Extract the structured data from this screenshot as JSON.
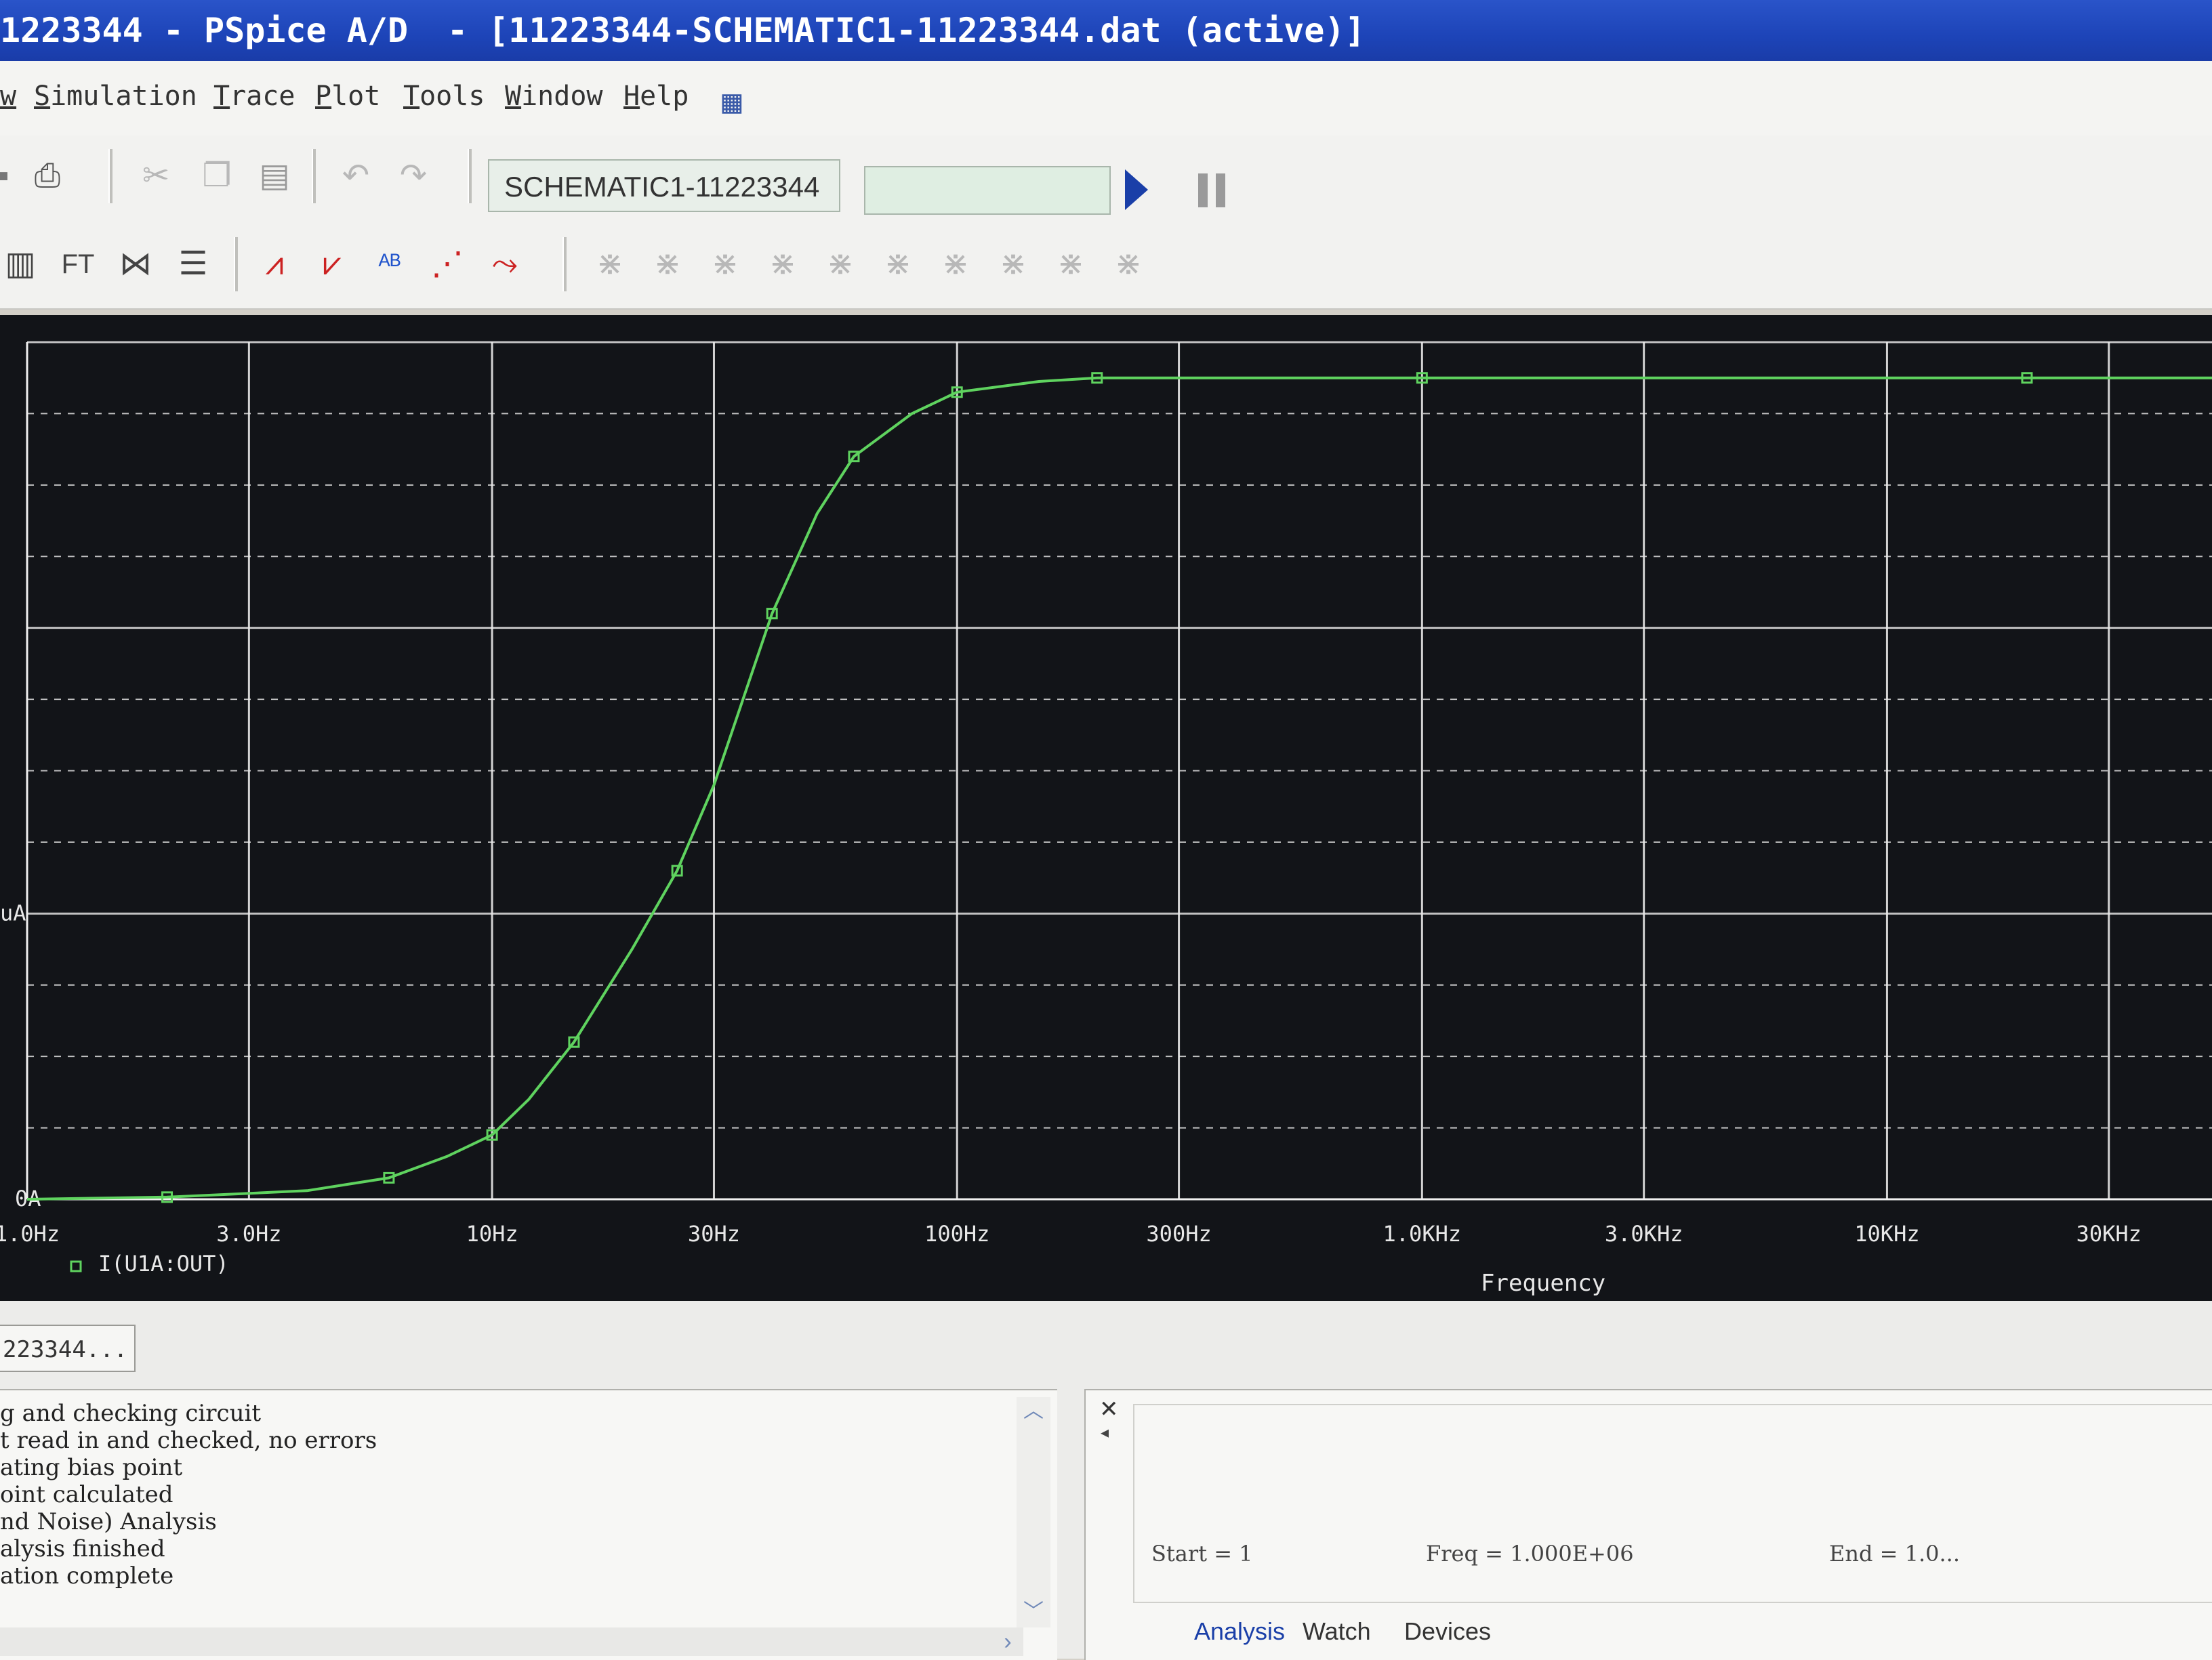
{
  "window": {
    "title_part1": "1223344 - PSpice A/D",
    "title_part2": "- [11223344-SCHEMATIC1-11223344.dat (active)]"
  },
  "menu": [
    "w",
    "Simulation",
    "Trace",
    "Plot",
    "Tools",
    "Window",
    "Help"
  ],
  "toolbar": {
    "profile": "SCHEMATIC1-11223344",
    "icons_row1": [
      "save-icon",
      "print-icon",
      "cut-icon",
      "copy-icon",
      "paste-icon",
      "undo-icon",
      "redo-icon",
      "run-icon",
      "pause-icon"
    ],
    "icons_row2": [
      "window-icon",
      "fft-icon",
      "performance-icon",
      "table-icon",
      "log-x-icon",
      "log-y-icon",
      "add-trace-icon",
      "eval-icon",
      "marker-icon",
      "cursor-icons"
    ]
  },
  "chart_data": {
    "type": "line",
    "xlabel": "Frequency",
    "x_scale": "log",
    "x_ticks": [
      "1.0Hz",
      "3.0Hz",
      "10Hz",
      "30Hz",
      "100Hz",
      "300Hz",
      "1.0KHz",
      "3.0KHz",
      "10KHz",
      "30KHz"
    ],
    "y_tick_labels": [
      "0A",
      "uA"
    ],
    "xlim": [
      1,
      50000
    ],
    "ylim": [
      0,
      1.2
    ],
    "grid": true,
    "series": [
      {
        "name": "I(U1A:OUT)",
        "color": "#5fd35f",
        "x": [
          1,
          2,
          4,
          6,
          8,
          10,
          12,
          15,
          20,
          25,
          30,
          40,
          50,
          60,
          80,
          100,
          150,
          200,
          300,
          1000,
          5000,
          20000,
          50000
        ],
        "y": [
          0,
          0.003,
          0.012,
          0.03,
          0.06,
          0.09,
          0.14,
          0.22,
          0.35,
          0.46,
          0.58,
          0.82,
          0.96,
          1.04,
          1.1,
          1.13,
          1.145,
          1.15,
          1.15,
          1.15,
          1.15,
          1.15,
          1.15
        ]
      }
    ]
  },
  "output_log": [
    "g and checking circuit",
    "t read in and checked, no errors",
    "ating bias point",
    "oint calculated",
    "nd Noise) Analysis",
    "alysis finished",
    "ation complete"
  ],
  "doc_tab": "223344...",
  "sim_status": {
    "start": "Start =  1",
    "freq": "Freq =  1.000E+06",
    "end": "End =  1.0..."
  },
  "sim_tabs": [
    "Analysis",
    "Watch",
    "Devices"
  ]
}
